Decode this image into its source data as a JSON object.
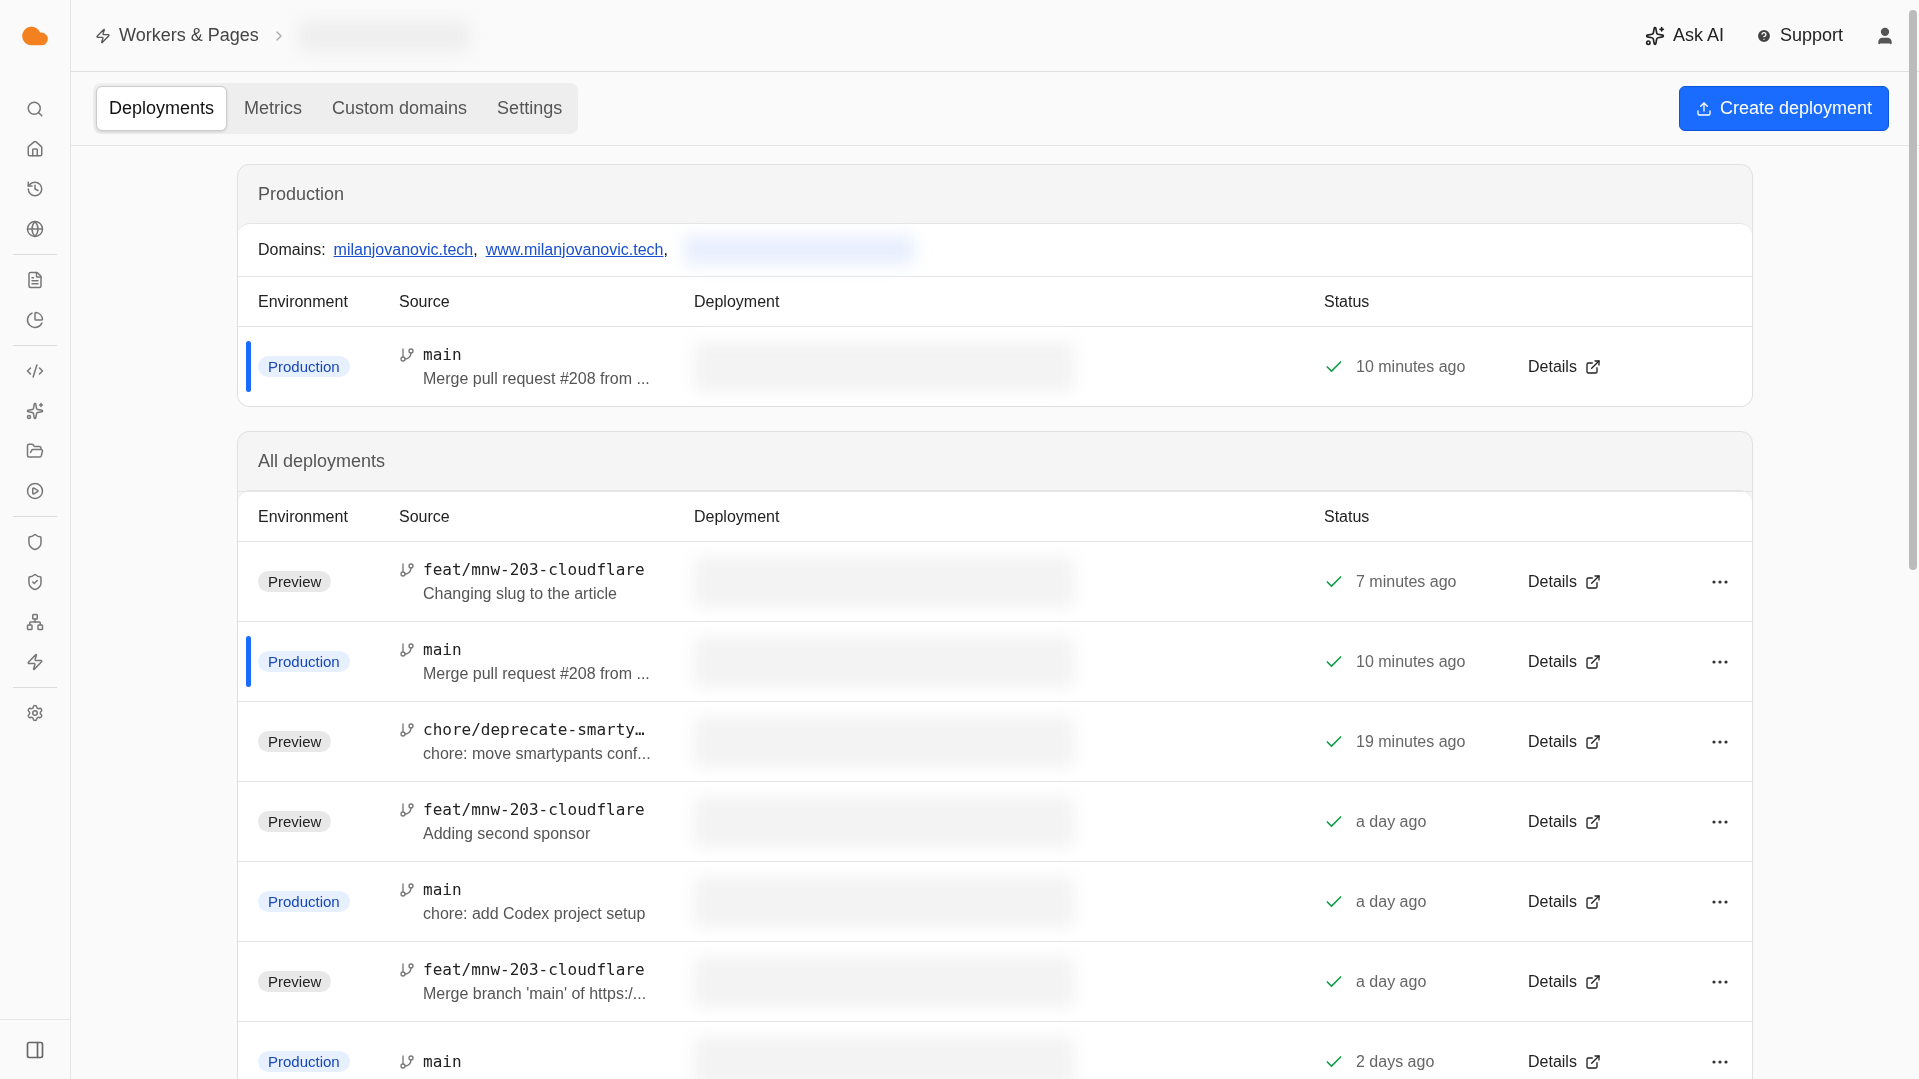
{
  "breadcrumb": {
    "section": "Workers & Pages"
  },
  "header_actions": [
    {
      "kind": "ai",
      "label": "Ask AI"
    },
    {
      "kind": "support",
      "label": "Support"
    }
  ],
  "tabs": [
    {
      "label": "Deployments",
      "selected": true
    },
    {
      "label": "Metrics",
      "selected": false
    },
    {
      "label": "Custom domains",
      "selected": false
    },
    {
      "label": "Settings",
      "selected": false
    }
  ],
  "primary_button": "Create deployment",
  "production": {
    "title": "Production",
    "domains_label": "Domains:",
    "domains": [
      "milanjovanovic.tech",
      "www.milanjovanovic.tech"
    ],
    "domain_separator": ",",
    "columns": [
      "Environment",
      "Source",
      "Deployment",
      "Status"
    ],
    "rows": [
      {
        "environment": "Production",
        "kind": "production",
        "current": true,
        "branch": "main",
        "message": "Merge pull request #208 from ...",
        "time": "10 minutes ago",
        "details": "Details"
      }
    ]
  },
  "all_deployments": {
    "title": "All deployments",
    "columns": [
      "Environment",
      "Source",
      "Deployment",
      "Status"
    ],
    "rows": [
      {
        "environment": "Preview",
        "kind": "preview",
        "current": false,
        "branch": "feat/mnw-203-cloudflare",
        "message": "Changing slug to the article",
        "time": "7 minutes ago",
        "details": "Details"
      },
      {
        "environment": "Production",
        "kind": "production",
        "current": true,
        "branch": "main",
        "message": "Merge pull request #208 from ...",
        "time": "10 minutes ago",
        "details": "Details"
      },
      {
        "environment": "Preview",
        "kind": "preview",
        "current": false,
        "branch": "chore/deprecate-smarty…",
        "message": "chore: move smartypants conf...",
        "time": "19 minutes ago",
        "details": "Details"
      },
      {
        "environment": "Preview",
        "kind": "preview",
        "current": false,
        "branch": "feat/mnw-203-cloudflare",
        "message": "Adding second sponsor",
        "time": "a day ago",
        "details": "Details"
      },
      {
        "environment": "Production",
        "kind": "production",
        "current": false,
        "branch": "main",
        "message": "chore: add Codex project setup",
        "time": "a day ago",
        "details": "Details"
      },
      {
        "environment": "Preview",
        "kind": "preview",
        "current": false,
        "branch": "feat/mnw-203-cloudflare",
        "message": "Merge branch 'main' of https:/...",
        "time": "a day ago",
        "details": "Details"
      },
      {
        "environment": "Production",
        "kind": "production",
        "current": false,
        "branch": "main",
        "time": "2 days ago",
        "details": "Details"
      }
    ]
  }
}
